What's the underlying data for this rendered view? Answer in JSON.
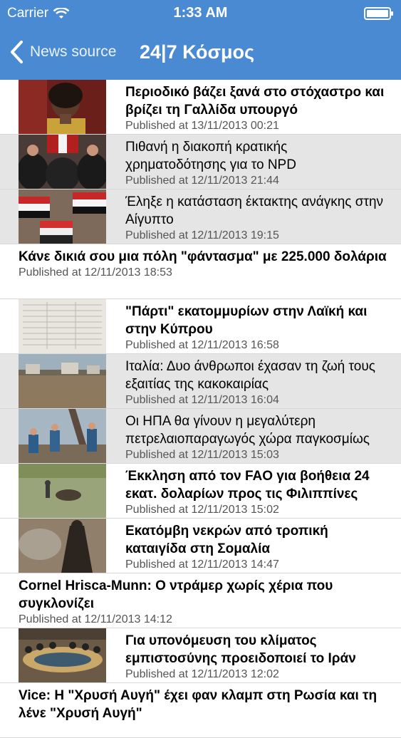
{
  "status": {
    "carrier": "Carrier",
    "time": "1:33 AM"
  },
  "nav": {
    "back_label": "News source",
    "title": "24|7 Κόσμος"
  },
  "items": [
    {
      "headline": "Περιοδικό βάζει ξανά στο στόχαστρο και βρίζει τη Γαλλίδα υπουργό",
      "date": "Published at 13/11/2013 00:21",
      "bold": true,
      "thumb": "portrait-woman"
    },
    {
      "headline": "Πιθανή η διακοπή κρατικής χρηματοδότησης για το NPD",
      "date": "Published at 12/11/2013 21:44",
      "bold": false,
      "thumb": "crowd-flags"
    },
    {
      "headline": "Έληξε η κατάσταση έκτακτης ανάγκης στην Αίγυπτο",
      "date": "Published at 12/11/2013 19:15",
      "bold": false,
      "thumb": "egypt-flags"
    },
    {
      "headline": "Κάνε δικιά σου μια πόλη \"φάντασμα\" με 225.000 δολάρια",
      "date": "Published at 12/11/2013 18:53",
      "bold": true,
      "thumb": null
    },
    {
      "headline": "\"Πάρτι\" εκατομμυρίων στην Λαϊκή και στην Κύπρου",
      "date": "Published at 12/11/2013 16:58",
      "bold": true,
      "thumb": "document"
    },
    {
      "headline": "Ιταλία: Δυο άνθρωποι έχασαν τη ζωή τους εξαιτίας της κακοκαιρίας",
      "date": "Published at 12/11/2013 16:04",
      "bold": false,
      "thumb": "flood"
    },
    {
      "headline": "Οι ΗΠΑ θα γίνουν η μεγαλύτερη πετρελαιοπαραγωγός χώρα παγκοσμίως",
      "date": "Published at 12/11/2013 15:03",
      "bold": false,
      "thumb": "oil-workers"
    },
    {
      "headline": "Έκκληση από τον FAO για βοήθεια 24 εκατ. δολαρίων προς τις Φιλιππίνες",
      "date": "Published at 12/11/2013 15:02",
      "bold": true,
      "thumb": "rice-field"
    },
    {
      "headline": "Εκατόμβη νεκρών από τροπική καταιγίδα στη Σομαλία",
      "date": "Published at 12/11/2013 14:47",
      "bold": true,
      "thumb": "storm"
    },
    {
      "headline": "Cornel Hrisca-Munn: Ο ντράμερ χωρίς χέρια που συγκλονίζει",
      "date": "Published at 12/11/2013 14:12",
      "bold": true,
      "thumb": null
    },
    {
      "headline": "Για υπονόμευση του κλίματος εμπιστοσύνης προειδοποιεί το Ιράν",
      "date": "Published at 12/11/2013 12:02",
      "bold": true,
      "thumb": "conference"
    },
    {
      "headline": "Vice: Η \"Χρυσή Αυγή\" έχει φαν κλαμπ στη Ρωσία και τη λένε \"Χρυσή Αυγή\"",
      "date": "",
      "bold": true,
      "thumb": null
    }
  ]
}
